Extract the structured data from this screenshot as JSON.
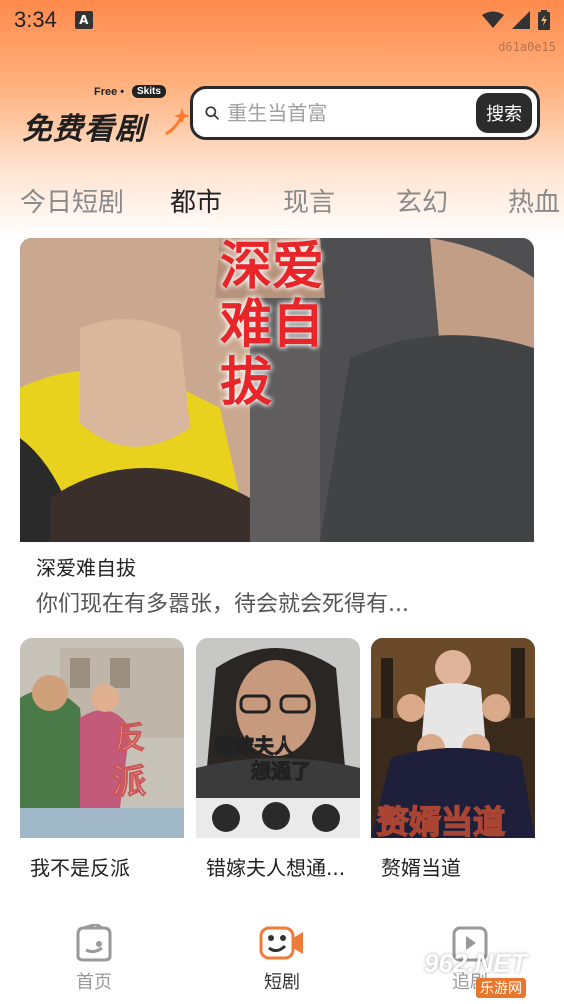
{
  "status": {
    "time": "3:34",
    "notification_badge": "A",
    "device_id": "d61a0e15"
  },
  "logo": {
    "free": "Free •",
    "skits": "Skits",
    "title": "免费看剧"
  },
  "search": {
    "placeholder": "重生当首富",
    "button_label": "搜索"
  },
  "tabs": [
    {
      "label": "今日短剧",
      "active": false
    },
    {
      "label": "都市",
      "active": true
    },
    {
      "label": "现言",
      "active": false
    },
    {
      "label": "玄幻",
      "active": false
    },
    {
      "label": "热血",
      "active": false
    }
  ],
  "featured": {
    "poster_text": "深爱难自拔",
    "title": "深爱难自拔",
    "description": "你们现在有多嚣张，待会就会死得有..."
  },
  "cards": [
    {
      "title": "我不是反派",
      "poster_text": "我不是反派"
    },
    {
      "title": "错嫁夫人想通...",
      "poster_text": "错嫁夫人想通了"
    },
    {
      "title": "赘婿当道",
      "poster_text": "赘婿当道"
    }
  ],
  "bottom_nav": [
    {
      "label": "首页",
      "icon": "home-icon",
      "active": false
    },
    {
      "label": "短剧",
      "icon": "short-drama-icon",
      "active": true
    },
    {
      "label": "追剧",
      "icon": "watchlist-icon",
      "active": false
    }
  ],
  "watermark": {
    "text": "962.NET",
    "sub": "乐游网"
  },
  "colors": {
    "accent": "#ff8a4c",
    "poster_red": "#e8262a",
    "nav_active": "#f07a3a"
  }
}
